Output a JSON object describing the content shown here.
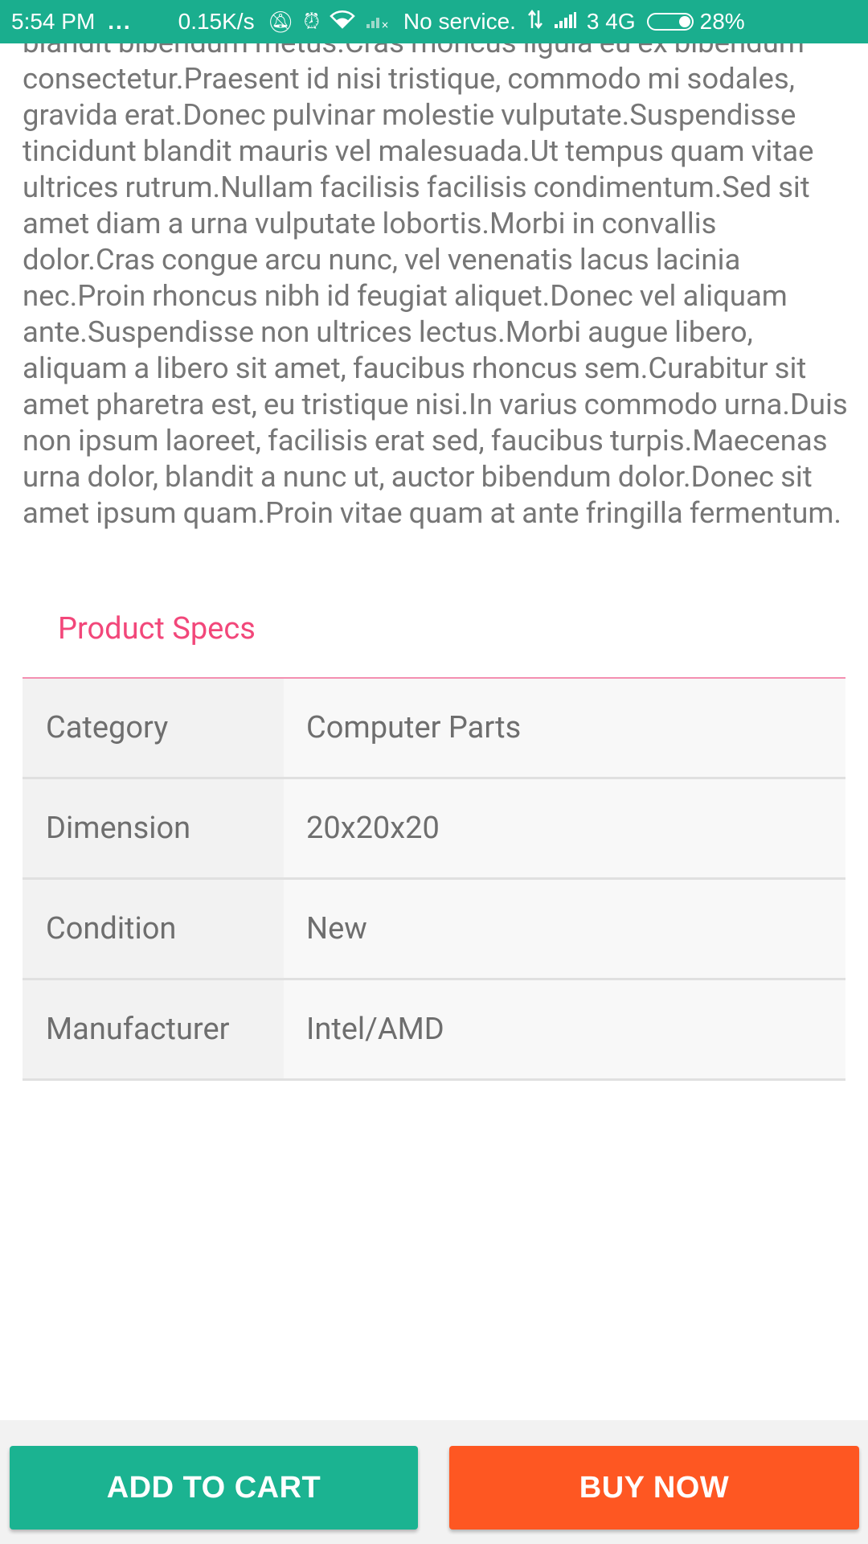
{
  "status_bar": {
    "time": "5:54 PM",
    "dots": "...",
    "speed": "0.15K/s",
    "service": "No service.",
    "carrier": "3 4G",
    "battery": "28%",
    "battery_level": 0.28
  },
  "description": "blandit bibendum metus.Cras rhoncus ligula eu ex bibendum consectetur.Praesent id nisi tristique, commodo mi sodales, gravida erat.Donec pulvinar molestie vulputate.Suspendisse tincidunt blandit mauris vel malesuada.Ut tempus quam vitae ultrices rutrum.Nullam facilisis facilisis condimentum.Sed sit amet diam a urna vulputate lobortis.Morbi in convallis dolor.Cras congue arcu nunc, vel venenatis lacus lacinia nec.Proin rhoncus nibh id feugiat aliquet.Donec vel aliquam ante.Suspendisse non ultrices lectus.Morbi augue libero, aliquam a libero sit amet, faucibus rhoncus sem.Curabitur sit amet pharetra est, eu tristique nisi.In varius commodo urna.Duis non ipsum laoreet, facilisis erat sed, faucibus turpis.Maecenas urna dolor, blandit a nunc ut, auctor bibendum dolor.Donec sit amet ipsum quam.Proin vitae quam at ante fringilla fermentum.",
  "specs": {
    "title": "Product Specs",
    "rows": [
      {
        "label": "Category",
        "value": "Computer Parts"
      },
      {
        "label": "Dimension",
        "value": "20x20x20"
      },
      {
        "label": "Condition",
        "value": "New"
      },
      {
        "label": "Manufacturer",
        "value": "Intel/AMD"
      }
    ]
  },
  "actions": {
    "add_to_cart": "ADD TO CART",
    "buy_now": "BUY NOW"
  },
  "colors": {
    "status_bar": "#1aae8e",
    "accent_pink": "#f2477a",
    "add_to_cart": "#1bb391",
    "buy_now": "#fe5722"
  }
}
